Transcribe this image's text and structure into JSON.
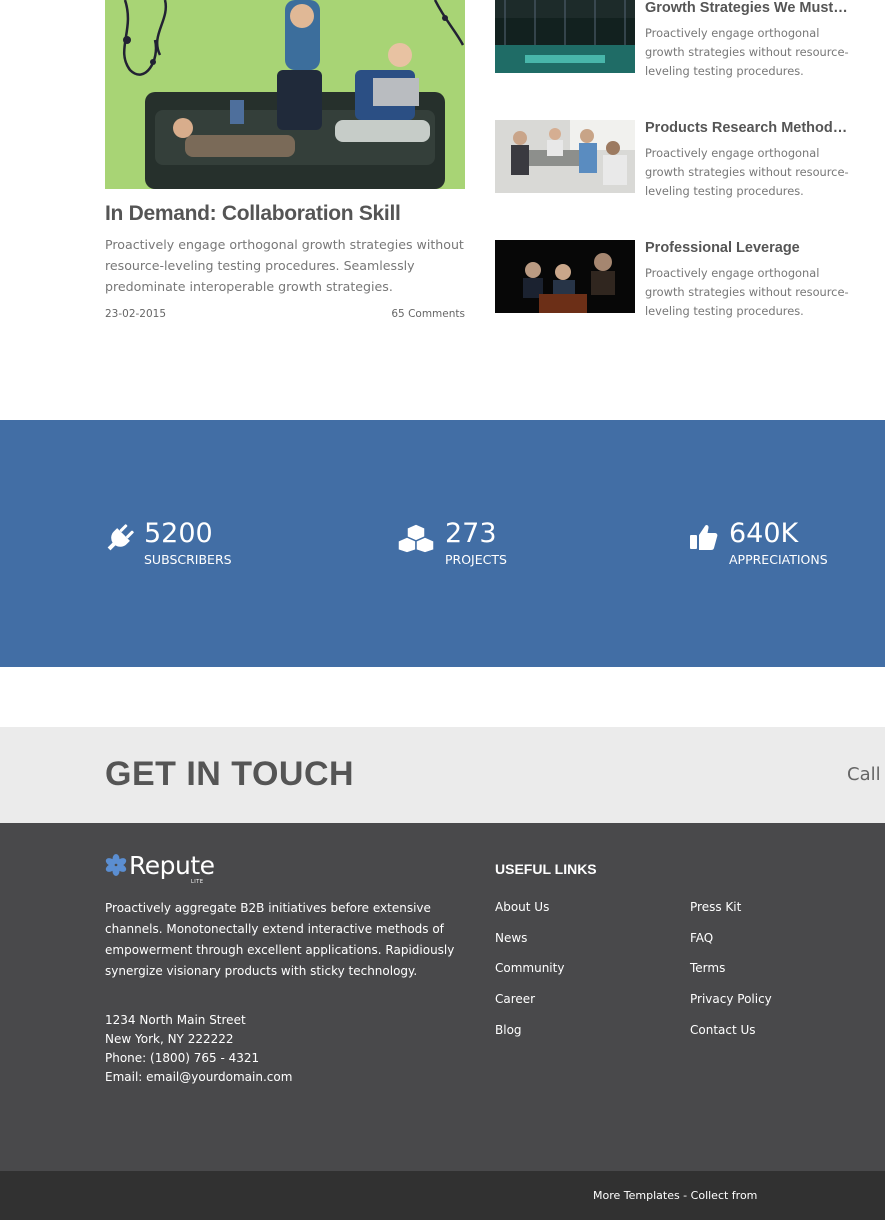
{
  "featured_post": {
    "title": "In Demand: Collaboration Skill",
    "excerpt": "Proactively engage orthogonal growth strategies without resource-leveling testing procedures. Seamlessly predominate interoperable growth strategies.",
    "date": "23-02-2015",
    "comments": "65 Comments"
  },
  "side_posts": [
    {
      "title": "Growth Strategies We Must K…",
      "excerpt": "Proactively engage orthogonal growth strategies without resource-leveling testing procedures."
    },
    {
      "title": "Products Research Methodolo…",
      "excerpt": "Proactively engage orthogonal growth strategies without resource-leveling testing procedures."
    },
    {
      "title": "Professional Leverage",
      "excerpt": "Proactively engage orthogonal growth strategies without resource-leveling testing procedures."
    }
  ],
  "stats": [
    {
      "icon": "plug-icon",
      "value": "5200",
      "label": "SUBSCRIBERS"
    },
    {
      "icon": "cubes-icon",
      "value": "273",
      "label": "PROJECTS"
    },
    {
      "icon": "thumbs-up-icon",
      "value": "640K",
      "label": "APPRECIATIONS"
    }
  ],
  "get_in_touch": {
    "title": "GET IN TOUCH",
    "call": "Call u"
  },
  "footer": {
    "logo": "Repute",
    "logo_sub": "LITE",
    "about": "Proactively aggregate B2B initiatives before extensive channels. Monotonectally extend interactive methods of empowerment through excellent applications. Rapidiously synergize visionary products with sticky technology.",
    "address": {
      "street": "1234 North Main Street",
      "city": "New York, NY 222222",
      "phone": "Phone: (1800) 765 - 4321",
      "email": "Email: email@yourdomain.com"
    },
    "links_heading": "USEFUL LINKS",
    "links_col1": [
      "About Us",
      "News",
      "Community",
      "Career",
      "Blog"
    ],
    "links_col2": [
      "Press Kit",
      "FAQ",
      "Terms",
      "Privacy Policy",
      "Contact Us"
    ],
    "bottom_text": "More Templates - Collect from"
  },
  "colors": {
    "stats_bg": "#426ea5",
    "touch_bg": "#ebebeb",
    "footer_bg": "#49494b",
    "bottom_bg": "#313131",
    "logo_accent": "#5b8ed1"
  }
}
